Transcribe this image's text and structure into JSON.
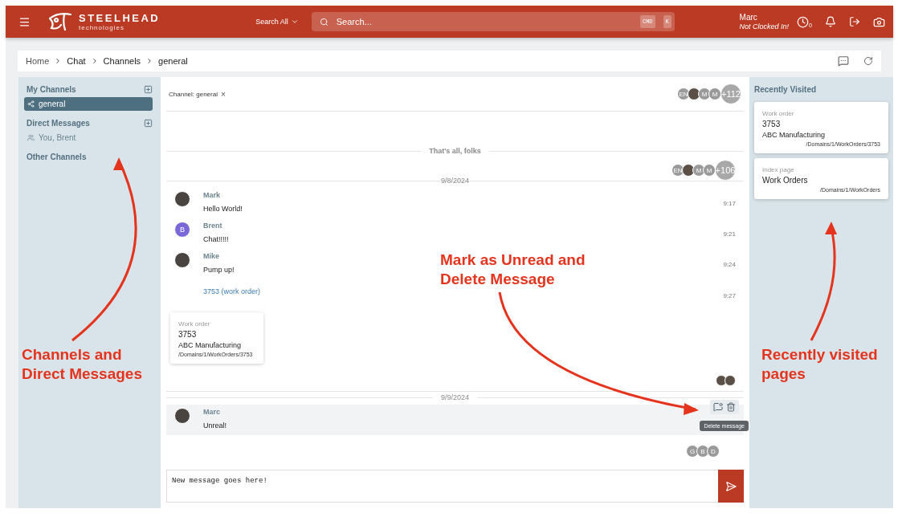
{
  "topbar": {
    "brand": "STEELHEAD",
    "brand_sub": "technologies",
    "search_scope": "Search All",
    "search": {
      "placeholder": "Search..."
    },
    "shortcut_keys": [
      "CMD",
      "K"
    ],
    "user": {
      "name": "Marc",
      "status": "Not Clocked In!"
    },
    "clock_count": "0"
  },
  "breadcrumbs": [
    "Home",
    "Chat",
    "Channels",
    "general"
  ],
  "sidebar": {
    "sections": [
      {
        "title": "My Channels",
        "addable": true,
        "items": [
          {
            "label": "general",
            "kind": "channel",
            "selected": true
          }
        ]
      },
      {
        "title": "Direct Messages",
        "addable": true,
        "items": [
          {
            "label": "You, Brent",
            "kind": "dm",
            "selected": false
          }
        ]
      },
      {
        "title": "Other Channels",
        "addable": false
      }
    ]
  },
  "chat": {
    "channel_chip": "Channel: general",
    "close_glyph": "×",
    "header_seen": [
      {
        "kind": "initials",
        "text": "EN"
      },
      {
        "kind": "photo"
      },
      {
        "kind": "initials",
        "text": "M"
      },
      {
        "kind": "initials",
        "text": "M"
      },
      {
        "kind": "more",
        "text": "+112"
      }
    ],
    "end_label": "That's all, folks",
    "end_seen": [
      {
        "kind": "initials",
        "text": "EN"
      },
      {
        "kind": "photo"
      },
      {
        "kind": "initials",
        "text": "M"
      },
      {
        "kind": "initials",
        "text": "M"
      },
      {
        "kind": "more",
        "text": "+106"
      }
    ],
    "days": [
      {
        "date": "9/8/2024",
        "messages": [
          {
            "author": "Mark",
            "avatar": {
              "kind": "photo"
            },
            "hovered": false,
            "parts": [
              {
                "kind": "text",
                "text": "Hello World!",
                "time": "9:17"
              }
            ]
          },
          {
            "author": "Brent",
            "avatar": {
              "kind": "initials",
              "text": "B",
              "color": "#7b68d8"
            },
            "hovered": false,
            "parts": [
              {
                "kind": "text",
                "text": "Chat!!!!!",
                "time": "9:21"
              }
            ]
          },
          {
            "author": "Mike",
            "avatar": {
              "kind": "photo"
            },
            "hovered": false,
            "parts": [
              {
                "kind": "text",
                "text": "Pump up!",
                "time": "9:24"
              },
              {
                "kind": "link",
                "text": "3753 (work order)",
                "time": "9:27"
              }
            ]
          }
        ],
        "card": {
          "type_label": "Work order",
          "title": "3753",
          "subtitle": "ABC Manufacturing",
          "path": "/Domains/1/WorkOrders/3753"
        },
        "seen": [
          {
            "kind": "photo"
          },
          {
            "kind": "photo"
          }
        ]
      },
      {
        "date": "9/9/2024",
        "messages": [
          {
            "author": "Marc",
            "avatar": {
              "kind": "photo"
            },
            "hovered": true,
            "tooltip": "Delete message",
            "parts": [
              {
                "kind": "text",
                "text": "Unreal!"
              }
            ]
          }
        ],
        "seen": [
          {
            "kind": "initials",
            "text": "G"
          },
          {
            "kind": "initials",
            "text": "B"
          },
          {
            "kind": "initials",
            "text": "D"
          }
        ]
      }
    ],
    "composer": {
      "value": "New message goes here!"
    }
  },
  "recent": {
    "title": "Recently Visited",
    "cards": [
      {
        "type_label": "Work order",
        "title": "3753",
        "subtitle": "ABC Manufacturing",
        "path": "/Domains/1/WorkOrders/3753"
      },
      {
        "type_label": "Index page",
        "title": "Work Orders",
        "path": "/Domains/1/WorkOrders"
      }
    ]
  },
  "annotations": {
    "sidebar": [
      "Channels and",
      "Direct Messages"
    ],
    "actions": [
      "Mark as Unread and",
      "Delete Message"
    ],
    "recent": [
      "Recently visited",
      "pages"
    ]
  }
}
